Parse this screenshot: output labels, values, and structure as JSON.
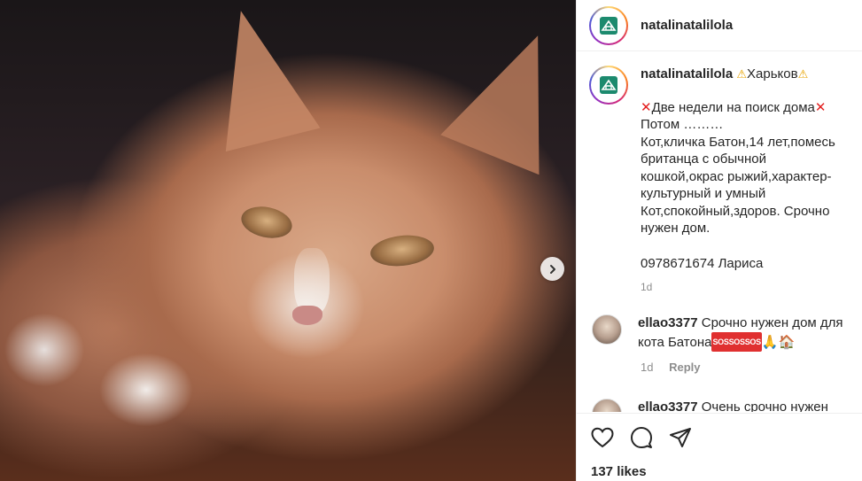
{
  "header": {
    "username": "natalinatalilola"
  },
  "post": {
    "caption_username": "natalinatalilola",
    "caption_location": "Харьков",
    "caption_line1": "Две недели на поиск дома",
    "caption_line2": "Потом ………",
    "caption_para": "Кот,кличка Батон,14 лет,помесь британца с обычной кошкой,окрас рыжий,характер-культурный и умный Кот,спокойный,здоров. Срочно нужен дом.",
    "caption_phone": "0978671674 Лариса",
    "caption_time": "1d"
  },
  "comments": [
    {
      "username": "ellao3377",
      "text_before": "Срочно нужен дом для кота Батона",
      "badge": "SOSSOSSOS",
      "emoji_tail": "🙏🏠",
      "time": "1d",
      "reply_label": "Reply"
    },
    {
      "username": "ellao3377",
      "text": "Очень срочно нужен"
    }
  ],
  "actions": {
    "likes": "137 likes"
  },
  "icons": {
    "photo_next": "chevron-right-icon",
    "like": "heart-icon",
    "comment": "comment-icon",
    "share": "paper-plane-icon"
  },
  "colors": {
    "warning": "#e8a400",
    "cross": "#e32020",
    "sos_badge": "#e03030",
    "muted": "#8e8e8e"
  }
}
